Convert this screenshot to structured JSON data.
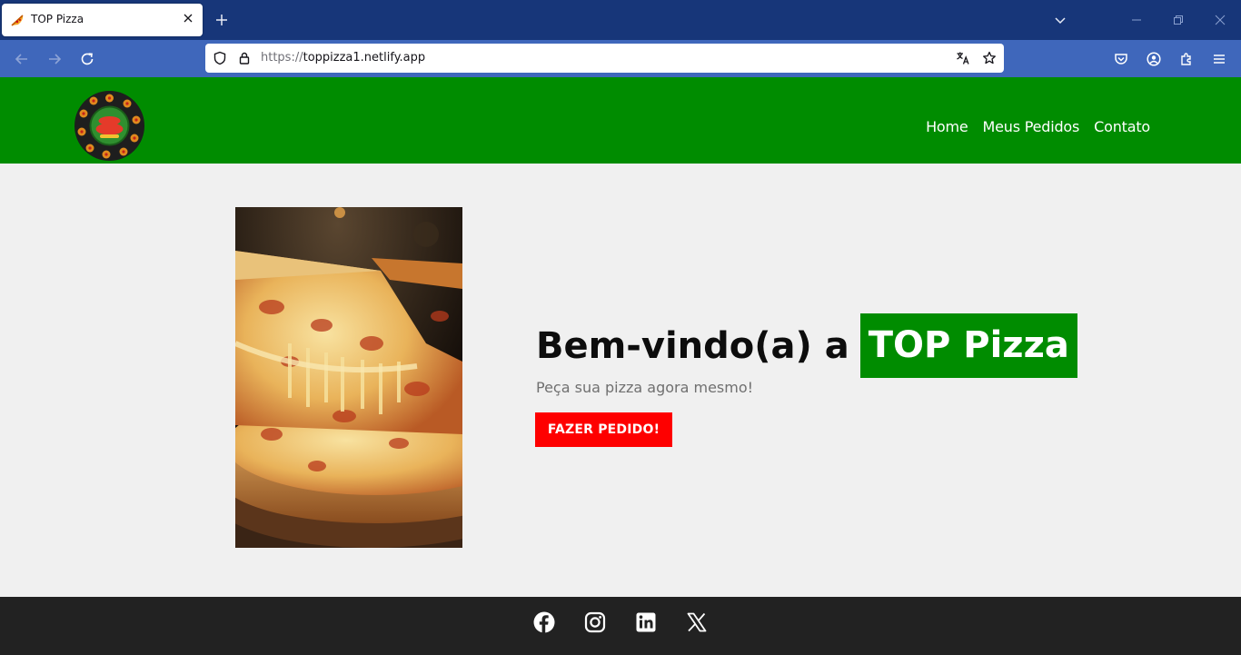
{
  "browser": {
    "tab_title": "TOP Pizza",
    "url_protocol": "https://",
    "url_host": "toppizza1.netlify.app",
    "chrome_color": "#173679",
    "toolbar_color": "#3f67bb"
  },
  "site": {
    "logo_alt": "TOP Pizza logo",
    "nav": [
      {
        "label": "Home"
      },
      {
        "label": "Meus Pedidos"
      },
      {
        "label": "Contato"
      }
    ],
    "hero": {
      "title_prefix": "Bem-vindo(a) a",
      "brand": "TOP Pizza",
      "subtitle": "Peça sua pizza agora mesmo!",
      "cta_label": "FAZER PEDIDO!"
    },
    "footer": {
      "socials": [
        {
          "icon": "facebook-icon"
        },
        {
          "icon": "instagram-icon"
        },
        {
          "icon": "linkedin-icon"
        },
        {
          "icon": "x-icon"
        }
      ]
    },
    "colors": {
      "brand_green": "#008c00",
      "cta_red": "#fe0000",
      "footer_dark": "#222222",
      "background": "#f0f0f0"
    }
  }
}
